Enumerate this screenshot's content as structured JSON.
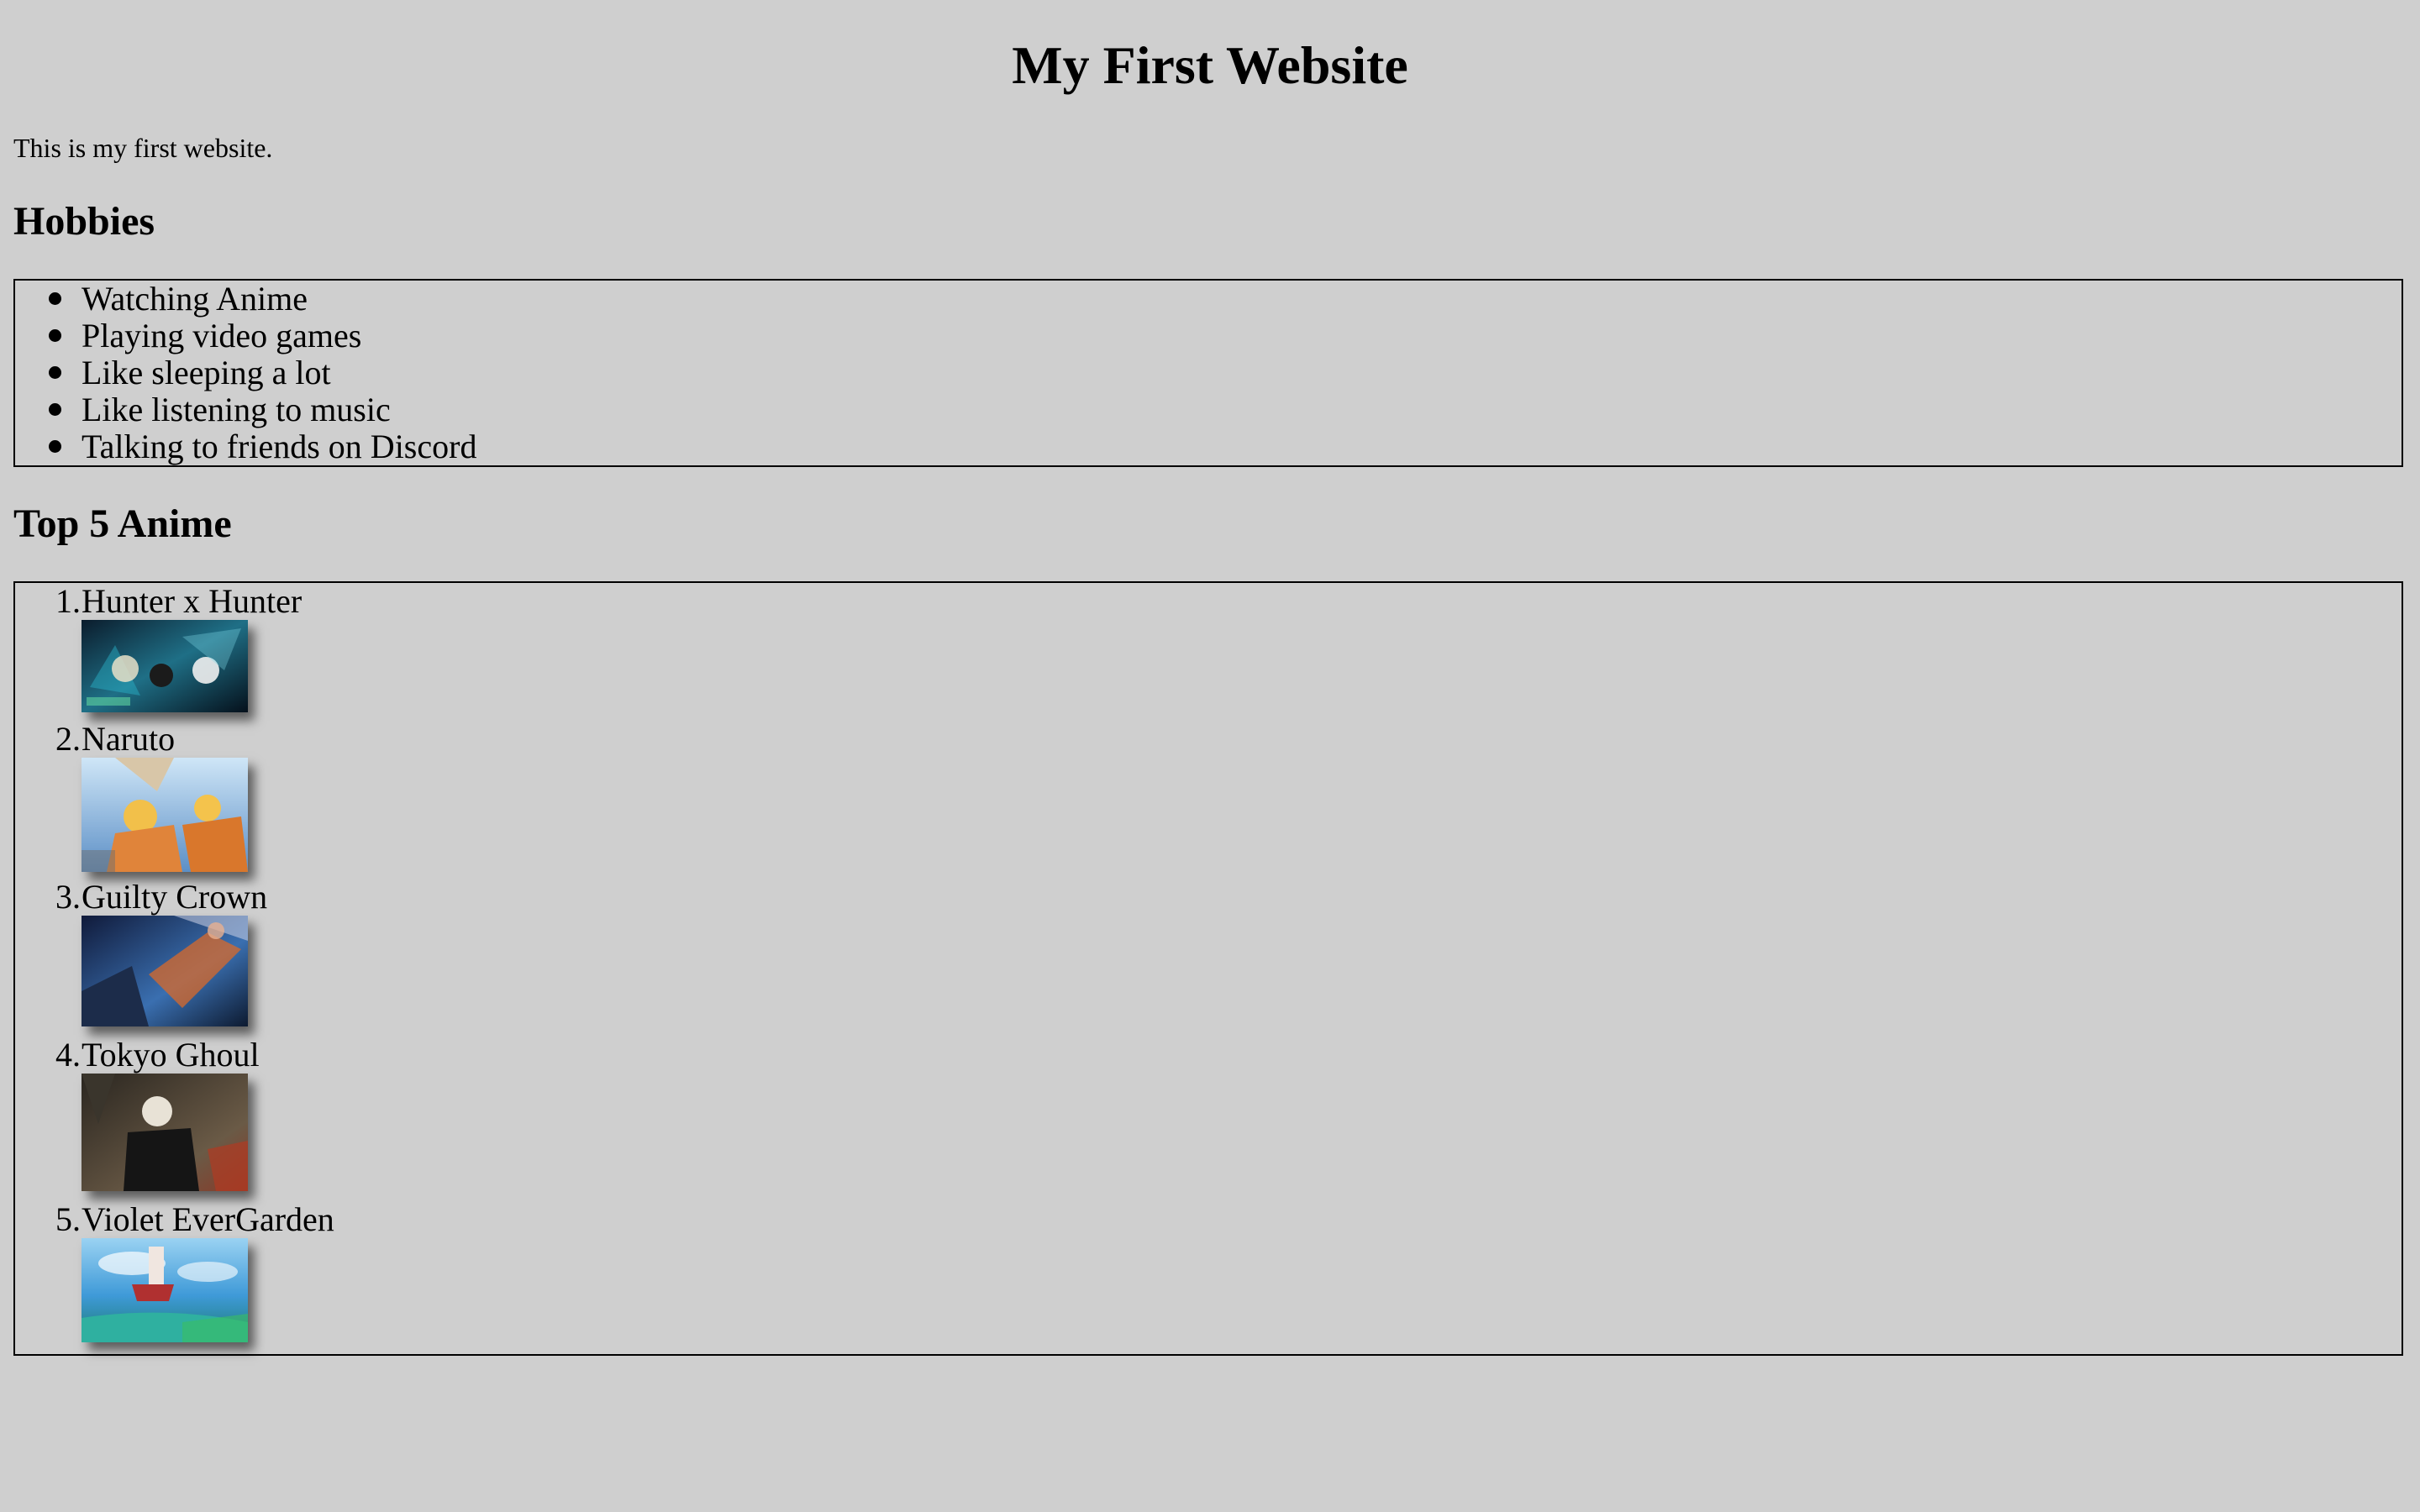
{
  "page": {
    "title": "My First Website",
    "intro": "This is my first website."
  },
  "hobbies": {
    "heading": "Hobbies",
    "items": [
      "Watching Anime",
      "Playing video games",
      "Like sleeping a lot",
      "Like listening to music",
      "Talking to friends on Discord"
    ]
  },
  "anime": {
    "heading": "Top 5 Anime",
    "items": [
      {
        "number": "1.",
        "title": "Hunter x Hunter"
      },
      {
        "number": "2.",
        "title": "Naruto"
      },
      {
        "number": "3.",
        "title": "Guilty Crown"
      },
      {
        "number": "4.",
        "title": "Tokyo Ghoul"
      },
      {
        "number": "5.",
        "title": "Violet EverGarden"
      }
    ]
  },
  "colors": {
    "background": "#cfcfcf",
    "text": "#000000",
    "border": "#000000"
  }
}
